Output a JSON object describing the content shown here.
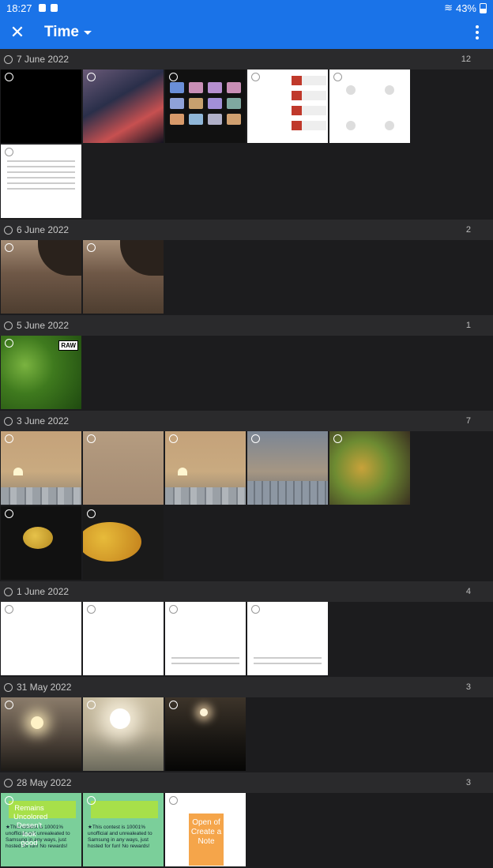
{
  "status_bar": {
    "time": "18:27",
    "battery": "43%"
  },
  "app_bar": {
    "title": "Time"
  },
  "groups": [
    {
      "date": "7 June 2022",
      "count": "12"
    },
    {
      "date": "6 June 2022",
      "count": "2"
    },
    {
      "date": "5 June 2022",
      "count": "1"
    },
    {
      "date": "3 June 2022",
      "count": "7"
    },
    {
      "date": "1 June 2022",
      "count": "4"
    },
    {
      "date": "31 May 2022",
      "count": "3"
    },
    {
      "date": "28 May 2022",
      "count": "3"
    }
  ],
  "badges": {
    "raw": "RAW"
  },
  "overlays": {
    "contest_note": "Remains Uncolored Desen't look good",
    "contest_body": "★This contest is 10001% unofficial and unrealeated to Samsung in any ways, just hosted for fun! No rewards!",
    "note_card": "Open of Create a Note"
  }
}
